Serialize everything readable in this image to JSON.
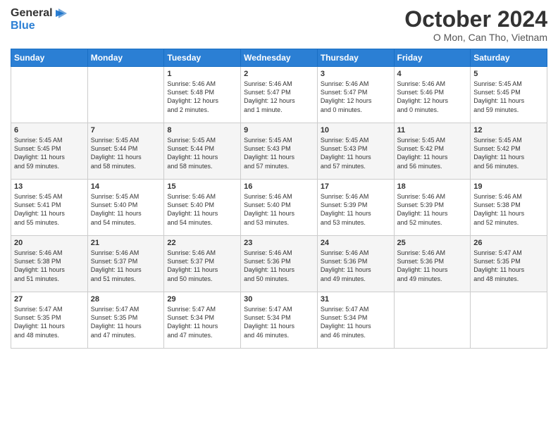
{
  "header": {
    "logo_general": "General",
    "logo_blue": "Blue",
    "month_title": "October 2024",
    "subtitle": "O Mon, Can Tho, Vietnam"
  },
  "days_of_week": [
    "Sunday",
    "Monday",
    "Tuesday",
    "Wednesday",
    "Thursday",
    "Friday",
    "Saturday"
  ],
  "weeks": [
    [
      {
        "day": "",
        "content": ""
      },
      {
        "day": "",
        "content": ""
      },
      {
        "day": "1",
        "content": "Sunrise: 5:46 AM\nSunset: 5:48 PM\nDaylight: 12 hours\nand 2 minutes."
      },
      {
        "day": "2",
        "content": "Sunrise: 5:46 AM\nSunset: 5:47 PM\nDaylight: 12 hours\nand 1 minute."
      },
      {
        "day": "3",
        "content": "Sunrise: 5:46 AM\nSunset: 5:47 PM\nDaylight: 12 hours\nand 0 minutes."
      },
      {
        "day": "4",
        "content": "Sunrise: 5:46 AM\nSunset: 5:46 PM\nDaylight: 12 hours\nand 0 minutes."
      },
      {
        "day": "5",
        "content": "Sunrise: 5:45 AM\nSunset: 5:45 PM\nDaylight: 11 hours\nand 59 minutes."
      }
    ],
    [
      {
        "day": "6",
        "content": "Sunrise: 5:45 AM\nSunset: 5:45 PM\nDaylight: 11 hours\nand 59 minutes."
      },
      {
        "day": "7",
        "content": "Sunrise: 5:45 AM\nSunset: 5:44 PM\nDaylight: 11 hours\nand 58 minutes."
      },
      {
        "day": "8",
        "content": "Sunrise: 5:45 AM\nSunset: 5:44 PM\nDaylight: 11 hours\nand 58 minutes."
      },
      {
        "day": "9",
        "content": "Sunrise: 5:45 AM\nSunset: 5:43 PM\nDaylight: 11 hours\nand 57 minutes."
      },
      {
        "day": "10",
        "content": "Sunrise: 5:45 AM\nSunset: 5:43 PM\nDaylight: 11 hours\nand 57 minutes."
      },
      {
        "day": "11",
        "content": "Sunrise: 5:45 AM\nSunset: 5:42 PM\nDaylight: 11 hours\nand 56 minutes."
      },
      {
        "day": "12",
        "content": "Sunrise: 5:45 AM\nSunset: 5:42 PM\nDaylight: 11 hours\nand 56 minutes."
      }
    ],
    [
      {
        "day": "13",
        "content": "Sunrise: 5:45 AM\nSunset: 5:41 PM\nDaylight: 11 hours\nand 55 minutes."
      },
      {
        "day": "14",
        "content": "Sunrise: 5:45 AM\nSunset: 5:40 PM\nDaylight: 11 hours\nand 54 minutes."
      },
      {
        "day": "15",
        "content": "Sunrise: 5:46 AM\nSunset: 5:40 PM\nDaylight: 11 hours\nand 54 minutes."
      },
      {
        "day": "16",
        "content": "Sunrise: 5:46 AM\nSunset: 5:40 PM\nDaylight: 11 hours\nand 53 minutes."
      },
      {
        "day": "17",
        "content": "Sunrise: 5:46 AM\nSunset: 5:39 PM\nDaylight: 11 hours\nand 53 minutes."
      },
      {
        "day": "18",
        "content": "Sunrise: 5:46 AM\nSunset: 5:39 PM\nDaylight: 11 hours\nand 52 minutes."
      },
      {
        "day": "19",
        "content": "Sunrise: 5:46 AM\nSunset: 5:38 PM\nDaylight: 11 hours\nand 52 minutes."
      }
    ],
    [
      {
        "day": "20",
        "content": "Sunrise: 5:46 AM\nSunset: 5:38 PM\nDaylight: 11 hours\nand 51 minutes."
      },
      {
        "day": "21",
        "content": "Sunrise: 5:46 AM\nSunset: 5:37 PM\nDaylight: 11 hours\nand 51 minutes."
      },
      {
        "day": "22",
        "content": "Sunrise: 5:46 AM\nSunset: 5:37 PM\nDaylight: 11 hours\nand 50 minutes."
      },
      {
        "day": "23",
        "content": "Sunrise: 5:46 AM\nSunset: 5:36 PM\nDaylight: 11 hours\nand 50 minutes."
      },
      {
        "day": "24",
        "content": "Sunrise: 5:46 AM\nSunset: 5:36 PM\nDaylight: 11 hours\nand 49 minutes."
      },
      {
        "day": "25",
        "content": "Sunrise: 5:46 AM\nSunset: 5:36 PM\nDaylight: 11 hours\nand 49 minutes."
      },
      {
        "day": "26",
        "content": "Sunrise: 5:47 AM\nSunset: 5:35 PM\nDaylight: 11 hours\nand 48 minutes."
      }
    ],
    [
      {
        "day": "27",
        "content": "Sunrise: 5:47 AM\nSunset: 5:35 PM\nDaylight: 11 hours\nand 48 minutes."
      },
      {
        "day": "28",
        "content": "Sunrise: 5:47 AM\nSunset: 5:35 PM\nDaylight: 11 hours\nand 47 minutes."
      },
      {
        "day": "29",
        "content": "Sunrise: 5:47 AM\nSunset: 5:34 PM\nDaylight: 11 hours\nand 47 minutes."
      },
      {
        "day": "30",
        "content": "Sunrise: 5:47 AM\nSunset: 5:34 PM\nDaylight: 11 hours\nand 46 minutes."
      },
      {
        "day": "31",
        "content": "Sunrise: 5:47 AM\nSunset: 5:34 PM\nDaylight: 11 hours\nand 46 minutes."
      },
      {
        "day": "",
        "content": ""
      },
      {
        "day": "",
        "content": ""
      }
    ]
  ]
}
